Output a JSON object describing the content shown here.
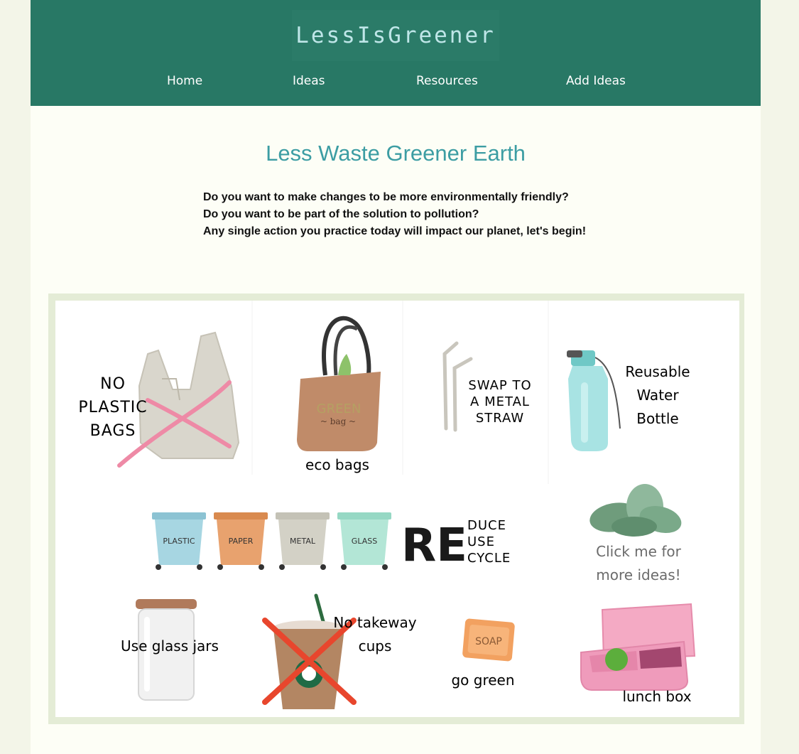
{
  "site": {
    "logo": "LessIsGreener"
  },
  "nav": [
    {
      "label": "Home"
    },
    {
      "label": "Ideas"
    },
    {
      "label": "Resources"
    },
    {
      "label": "Add Ideas"
    }
  ],
  "main": {
    "title": "Less Waste Greener Earth",
    "intro": [
      "Do you want to make changes to be more environmentally friendly?",
      "Do you want to be part of the solution to pollution?",
      "Any single action you practice today will impact our planet, let's begin!"
    ]
  },
  "poster": {
    "no_plastic": [
      "NO",
      "PLASTIC",
      "BAGS"
    ],
    "eco_bags": "eco bags",
    "bag_text": [
      "GREEN",
      "~ bag ~"
    ],
    "straw": [
      "SWAP TO",
      "A METAL",
      "STRAW"
    ],
    "bottle": [
      "Reusable",
      "Water",
      "Bottle"
    ],
    "bins": [
      "PLASTIC",
      "PAPER",
      "METAL",
      "GLASS"
    ],
    "re_big": "RE",
    "re_words": [
      "DUCE",
      "USE",
      "CYCLE"
    ],
    "click_more": [
      "Click me for",
      "more ideas!"
    ],
    "glass_jars": "Use glass jars",
    "takeaway": [
      "No takeway",
      "cups"
    ],
    "soap": "SOAP",
    "go_green": "go green",
    "lunch_box": "lunch box"
  },
  "colors": {
    "header": "#287865",
    "title": "#3c9da3",
    "page_bg": "#fdfef6",
    "outer_bg": "#f3f5e8",
    "frame": "#e4ecd6"
  }
}
